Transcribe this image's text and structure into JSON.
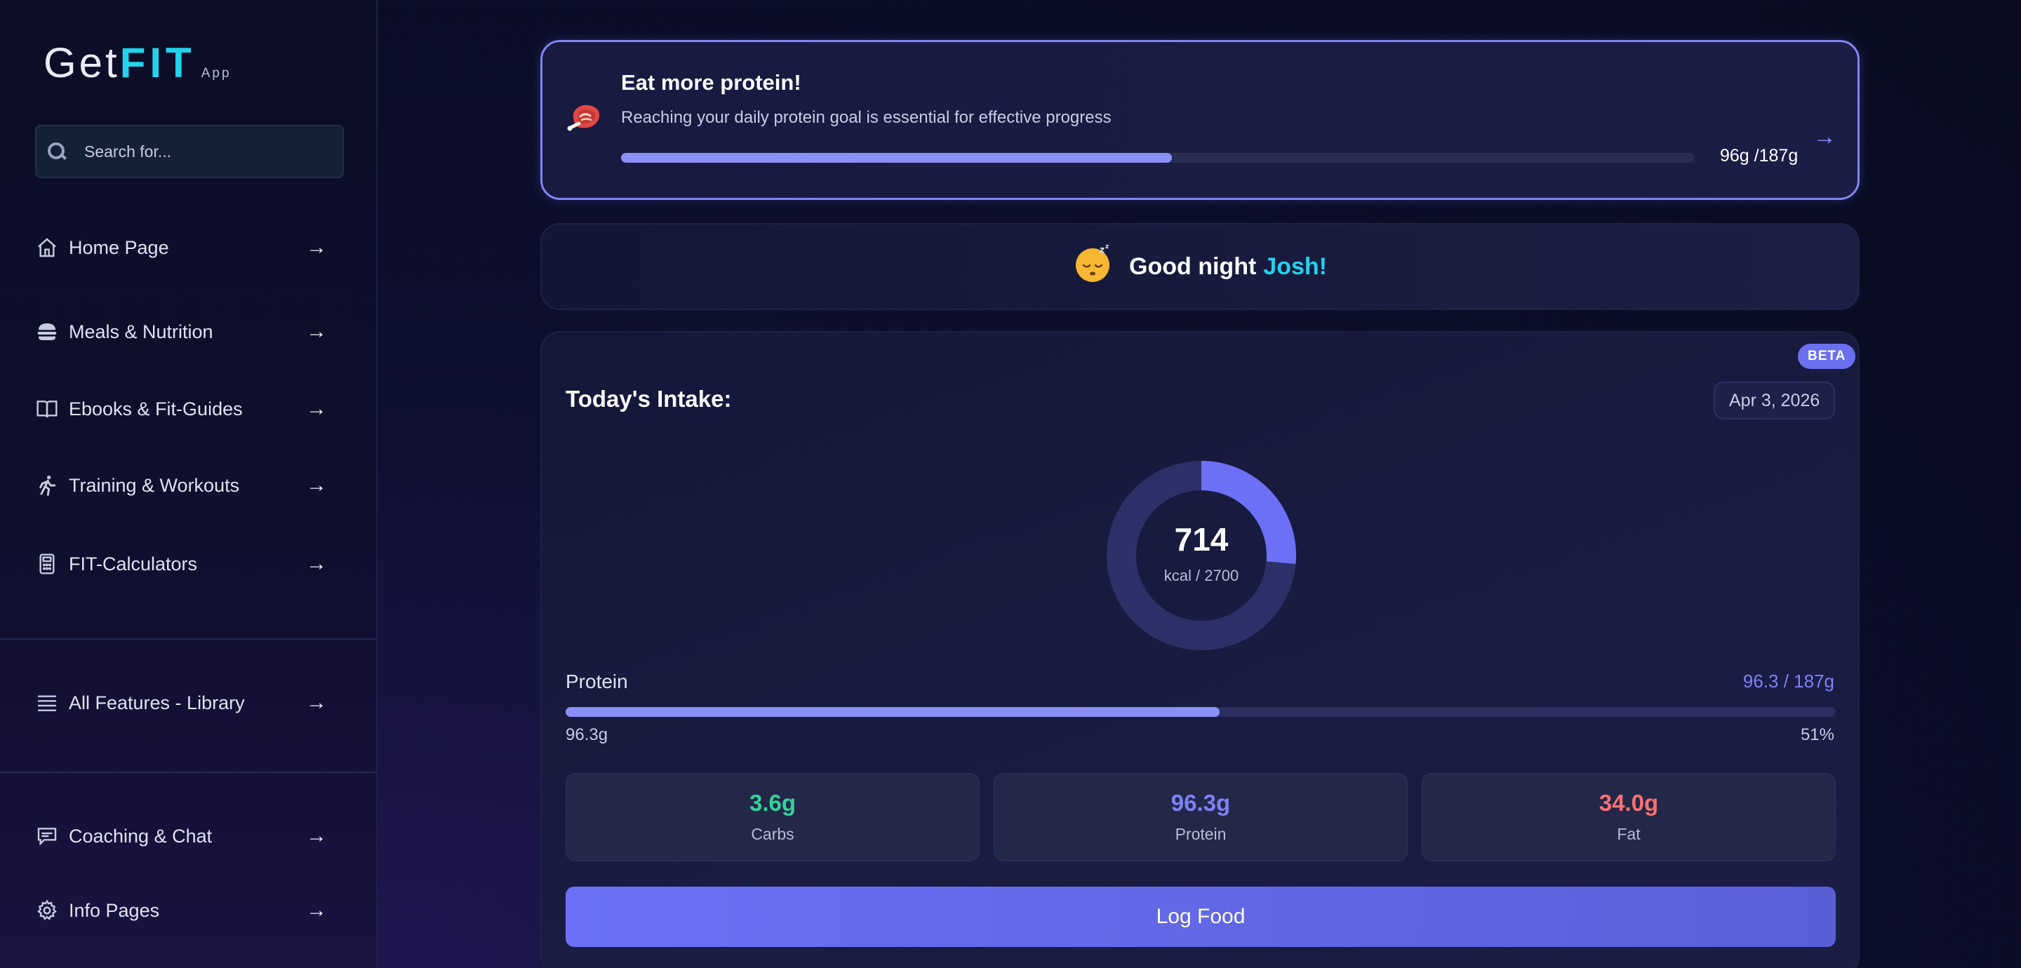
{
  "brand": {
    "get": "Get",
    "fit": "FIT",
    "app": "App"
  },
  "search": {
    "placeholder": "Search for..."
  },
  "nav": {
    "home": "Home Page",
    "meals": "Meals & Nutrition",
    "ebooks": "Ebooks & Fit-Guides",
    "training": "Training & Workouts",
    "calculators": "FIT-Calculators",
    "library": "All Features - Library",
    "coaching": "Coaching & Chat",
    "info": "Info Pages",
    "arrow": "→"
  },
  "protein_banner": {
    "title": "Eat more protein!",
    "subtitle": "Reaching your daily protein goal is essential for effective progress",
    "progress_fraction": 0.513,
    "progress_text": "96g /187g",
    "arrow": "→"
  },
  "greeting": {
    "text": "Good night",
    "name": "Josh!"
  },
  "intake": {
    "badge": "BETA",
    "title": "Today's Intake:",
    "date": "Apr 3, 2026",
    "kcal_value": "714",
    "kcal_sub": "kcal / 2700",
    "kcal_fraction": 0.264,
    "macro_label": "Protein",
    "macro_value": "96.3 / 187g",
    "macro_fraction": 0.515,
    "macro_grams": "96.3g",
    "macro_pct": "51%",
    "stats": [
      {
        "value": "3.6g",
        "label": "Carbs",
        "color": "#34d399"
      },
      {
        "value": "96.3g",
        "label": "Protein",
        "color": "#7c82f5"
      },
      {
        "value": "34.0g",
        "label": "Fat",
        "color": "#f87171"
      }
    ],
    "log_button": "Log Food"
  },
  "colors": {
    "accent": "#6b70f0",
    "brand_cyan": "#22d3ee",
    "donut_track": "#2d3068"
  }
}
